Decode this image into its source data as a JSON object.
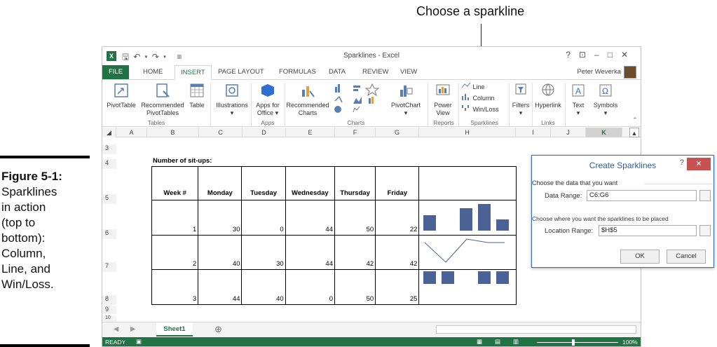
{
  "callout": "Choose a sparkline",
  "caption": {
    "label": "Figure 5-1:",
    "lines": [
      "Sparklines",
      "in action",
      "(top to",
      "bottom):",
      "Column,",
      "Line, and",
      "Win/Loss."
    ]
  },
  "window": {
    "title": "Sparklines - Excel",
    "logo": "X≣",
    "user": "Peter Weverka",
    "controls": [
      "?",
      "⊡",
      "–",
      "□",
      "✕"
    ]
  },
  "tabs": [
    "FILE",
    "HOME",
    "INSERT",
    "PAGE LAYOUT",
    "FORMULAS",
    "DATA",
    "REVIEW",
    "VIEW"
  ],
  "ribbon": {
    "buttons": [
      {
        "label": "PivotTable",
        "label2": ""
      },
      {
        "label": "Recommended",
        "label2": "PivotTables"
      },
      {
        "label": "Table",
        "label2": ""
      },
      {
        "label": "Illustrations",
        "label2": "▾"
      },
      {
        "label": "Apps for",
        "label2": "Office ▾"
      },
      {
        "label": "Recommended",
        "label2": "Charts"
      },
      {
        "label": "PivotChart",
        "label2": "▾"
      },
      {
        "label": "Power",
        "label2": "View"
      },
      {
        "label": "Filters",
        "label2": "▾"
      },
      {
        "label": "Hyperlink",
        "label2": ""
      },
      {
        "label": "Text",
        "label2": "▾"
      },
      {
        "label": "Symbols",
        "label2": "▾"
      }
    ],
    "sparklines": [
      "Line",
      "Column",
      "Win/Loss"
    ],
    "groups": [
      "Tables",
      "Apps",
      "Charts",
      "Reports",
      "Sparklines",
      "Links"
    ]
  },
  "columns": [
    "A",
    "B",
    "C",
    "D",
    "E",
    "F",
    "G",
    "H",
    "I",
    "J",
    "K"
  ],
  "rows": [
    "3",
    "4",
    "5",
    "6",
    "7",
    "8",
    "9",
    "10"
  ],
  "sheet": {
    "title": "Number of sit-ups:",
    "headers": [
      "Week #",
      "Monday",
      "Tuesday",
      "Wednesday",
      "Thursday",
      "Friday"
    ],
    "data": [
      [
        "1",
        "30",
        "0",
        "44",
        "50",
        "22"
      ],
      [
        "2",
        "40",
        "30",
        "44",
        "42",
        "42"
      ],
      [
        "3",
        "44",
        "40",
        "0",
        "50",
        "25"
      ]
    ],
    "sparkline_color": "#4a6295"
  },
  "dialog": {
    "title": "Create Sparklines",
    "help": "?",
    "close": "✕",
    "section1": "Choose the data that you want",
    "data_range_label": "Data Range:",
    "data_range_value": "C6:G6",
    "section2": "Choose where you want the sparklines to be placed",
    "location_label": "Location Range:",
    "location_value": "$H$5",
    "ok": "OK",
    "cancel": "Cancel"
  },
  "sheet_tab": "Sheet1",
  "status": {
    "ready": "READY",
    "zoom": "100%"
  },
  "colors": {
    "excel_green": "#217346",
    "dialog_blue": "#2c6fb7",
    "close_red": "#c75050"
  }
}
